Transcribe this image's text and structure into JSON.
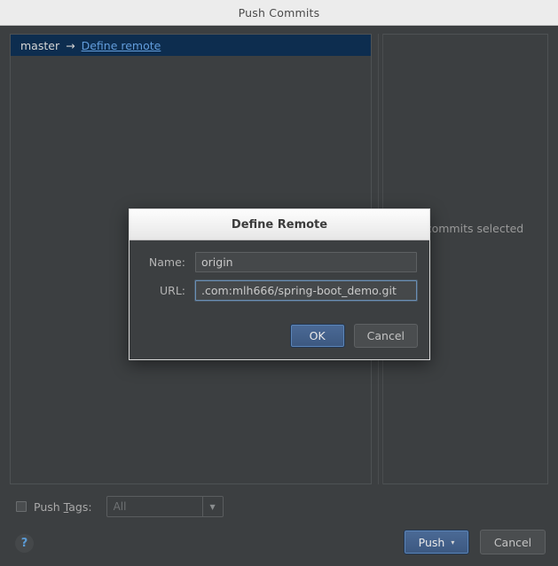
{
  "window": {
    "title": "Push Commits"
  },
  "toolbar": {
    "icons": [
      {
        "name": "cherry-pick-icon",
        "glyph": "✦",
        "state": "disabled"
      },
      {
        "name": "edit-commit-message-icon",
        "glyph": "✎",
        "state": "disabled"
      },
      {
        "name": "show-details-icon",
        "glyph": "▣",
        "state": "pressed"
      },
      {
        "name": "expand-all-icon",
        "glyph": "⤓",
        "state": "normal"
      },
      {
        "name": "collapse-all-icon",
        "glyph": "⤒",
        "state": "normal"
      }
    ]
  },
  "left_pane": {
    "branch_row": {
      "source_branch": "master",
      "arrow": "→",
      "target_link": "Define remote"
    }
  },
  "right_pane": {
    "empty_message": "No commits selected"
  },
  "push_tags": {
    "label_before": "Push ",
    "label_mnemonic": "T",
    "label_after": "ags:",
    "checked": false,
    "combo_value": "All",
    "combo_arrow": "▼"
  },
  "help": {
    "glyph": "?"
  },
  "bottom_buttons": {
    "push_label": "Push",
    "push_caret": "▾",
    "cancel_label": "Cancel"
  },
  "dialog": {
    "title": "Define Remote",
    "name_label": "Name:",
    "name_value": "origin",
    "url_label": "URL:",
    "url_value": ".com:mlh666/spring-boot_demo.git",
    "ok_label": "OK",
    "cancel_label": "Cancel"
  }
}
